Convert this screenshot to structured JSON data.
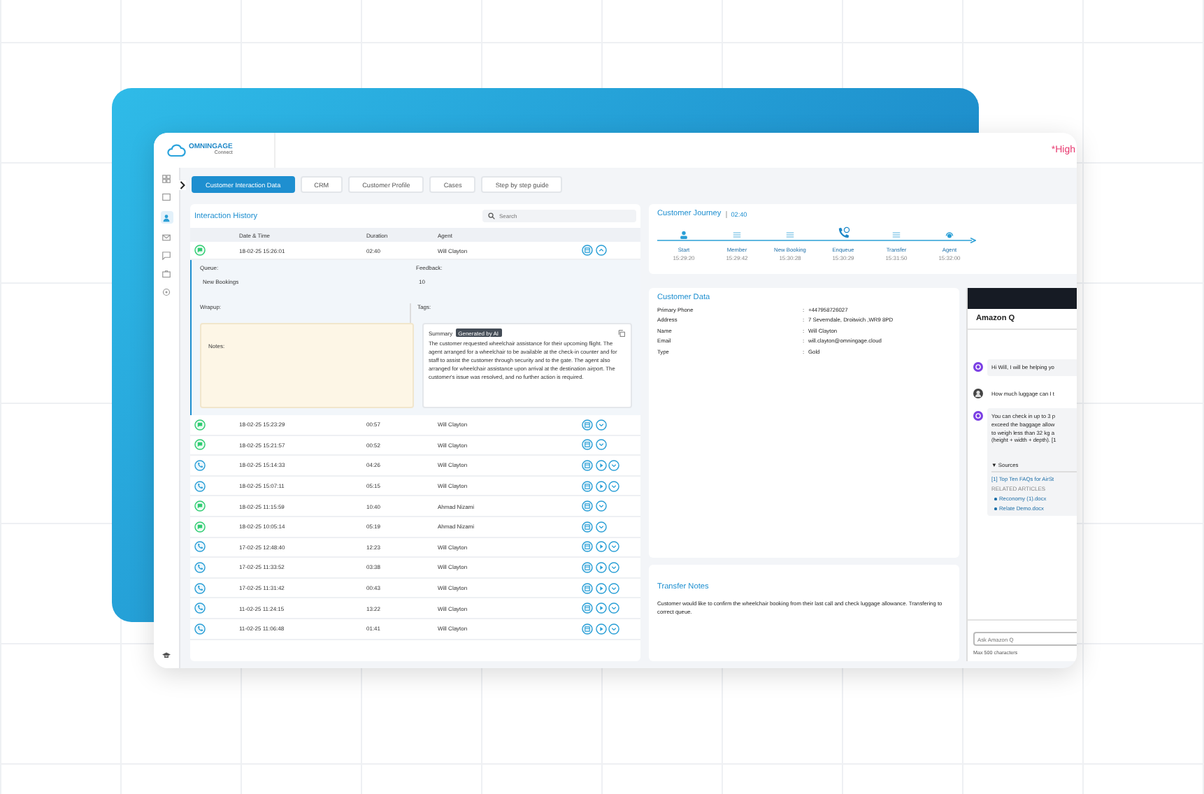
{
  "header": {
    "logo_name": "OMNINGAGE",
    "logo_tagline": "Connect",
    "priority": "*High"
  },
  "tabs": [
    {
      "label": "Customer Interaction Data",
      "selected": true
    },
    {
      "label": "CRM",
      "selected": false
    },
    {
      "label": "Customer Profile",
      "selected": false
    },
    {
      "label": "Cases",
      "selected": false
    },
    {
      "label": "Step by step guide",
      "selected": false
    }
  ],
  "interaction_history": {
    "title": "Interaction History",
    "search": {
      "placeholder": "Search"
    },
    "columns": [
      "Date & Time",
      "Duration",
      "Agent"
    ],
    "rows": [
      {
        "kind": "chat",
        "datetime": "18-02-25 15:26:01",
        "duration": "02:40",
        "agent": "Will Clayton",
        "expanded": true,
        "details": {
          "queue_label": "Queue:",
          "queue": "New Bookings",
          "feedback_label": "Feedback:",
          "feedback": "10",
          "wrapup_label": "Wrapup:",
          "tags_label": "Tags:",
          "notes_label": "Notes:",
          "summary_label": "Summary",
          "summary_badge": "Generated by AI",
          "summary": "The customer requested wheelchair assistance for their upcoming flight. The agent arranged for a wheelchair to be available at the check-in counter and for staff to assist the customer through security and to the gate. The agent also arranged for wheelchair assistance upon arrival at the destination airport. The customer's issue was resolved, and no further action is required."
        }
      },
      {
        "kind": "chat",
        "datetime": "18-02-25 15:23:29",
        "duration": "00:57",
        "agent": "Will Clayton",
        "expanded": false
      },
      {
        "kind": "chat",
        "datetime": "18-02-25 15:21:57",
        "duration": "00:52",
        "agent": "Will Clayton",
        "expanded": false
      },
      {
        "kind": "call",
        "datetime": "18-02-25 15:14:33",
        "duration": "04:26",
        "agent": "Will Clayton",
        "expanded": false
      },
      {
        "kind": "call",
        "datetime": "18-02-25 15:07:11",
        "duration": "05:15",
        "agent": "Will Clayton",
        "expanded": false
      },
      {
        "kind": "chat",
        "datetime": "18-02-25 11:15:59",
        "duration": "10:40",
        "agent": "Ahmad Nizami",
        "expanded": false
      },
      {
        "kind": "chat",
        "datetime": "18-02-25 10:05:14",
        "duration": "05:19",
        "agent": "Ahmad Nizami",
        "expanded": false
      },
      {
        "kind": "call",
        "datetime": "17-02-25 12:48:40",
        "duration": "12:23",
        "agent": "Will Clayton",
        "expanded": false
      },
      {
        "kind": "call",
        "datetime": "17-02-25 11:33:52",
        "duration": "03:38",
        "agent": "Will Clayton",
        "expanded": false
      },
      {
        "kind": "call",
        "datetime": "17-02-25 11:31:42",
        "duration": "00:43",
        "agent": "Will Clayton",
        "expanded": false
      },
      {
        "kind": "call",
        "datetime": "11-02-25 11:24:15",
        "duration": "13:22",
        "agent": "Will Clayton",
        "expanded": false
      },
      {
        "kind": "call",
        "datetime": "11-02-25 11:06:48",
        "duration": "01:41",
        "agent": "Will Clayton",
        "expanded": false
      }
    ]
  },
  "customer_journey": {
    "title": "Customer Journey",
    "duration": "02:40",
    "steps": [
      {
        "kind": "person",
        "label": "Start",
        "time": "15:29:20"
      },
      {
        "kind": "list",
        "label": "Member",
        "time": "15:29:42"
      },
      {
        "kind": "list",
        "label": "New Booking",
        "time": "15:30:28"
      },
      {
        "kind": "phone",
        "label": "Enqueue",
        "time": "15:30:29"
      },
      {
        "kind": "list",
        "label": "Transfer",
        "time": "15:31:50"
      },
      {
        "kind": "headset",
        "label": "Agent",
        "time": "15:32:00"
      }
    ]
  },
  "customer_data": {
    "title": "Customer Data",
    "fields": [
      {
        "label": "Primary Phone",
        "separator": ":",
        "value": "+447958726027"
      },
      {
        "label": "Address",
        "separator": ":",
        "value": "7 Severndale, Droitwich ,WR9 8PD"
      },
      {
        "label": "Name",
        "separator": ":",
        "value": "Will Clayton"
      },
      {
        "label": "Email",
        "separator": ":",
        "value": "will.clayton@omningage.cloud"
      },
      {
        "label": "Type",
        "separator": ":",
        "value": "Gold"
      }
    ]
  },
  "transfer_notes": {
    "title": "Transfer Notes",
    "text": "Customer would like to confirm the wheelchair booking from their last call and check luggage allowance. Transfering to correct queue."
  },
  "amazon_q": {
    "title": "Amazon Q",
    "messages": [
      {
        "kind": "bot",
        "text": "Hi Will, I will be helping yo"
      },
      {
        "kind": "user",
        "text": "How much luggage can I t"
      },
      {
        "kind": "bot",
        "text": "You can check in up to 3 p\nexceed the baggage allow\nto weigh less than 32 kg a\n(height + width + depth). [1",
        "sources_label": "▼ Sources",
        "source": "[1] Top Ten FAQs for AirSt",
        "related_label": "RELATED ARTICLES",
        "articles": [
          "Reconomy (1).docx",
          "Relate Demo.docx"
        ]
      }
    ],
    "input": {
      "placeholder": "Ask Amazon Q"
    },
    "limit": "Max 500 characters"
  }
}
